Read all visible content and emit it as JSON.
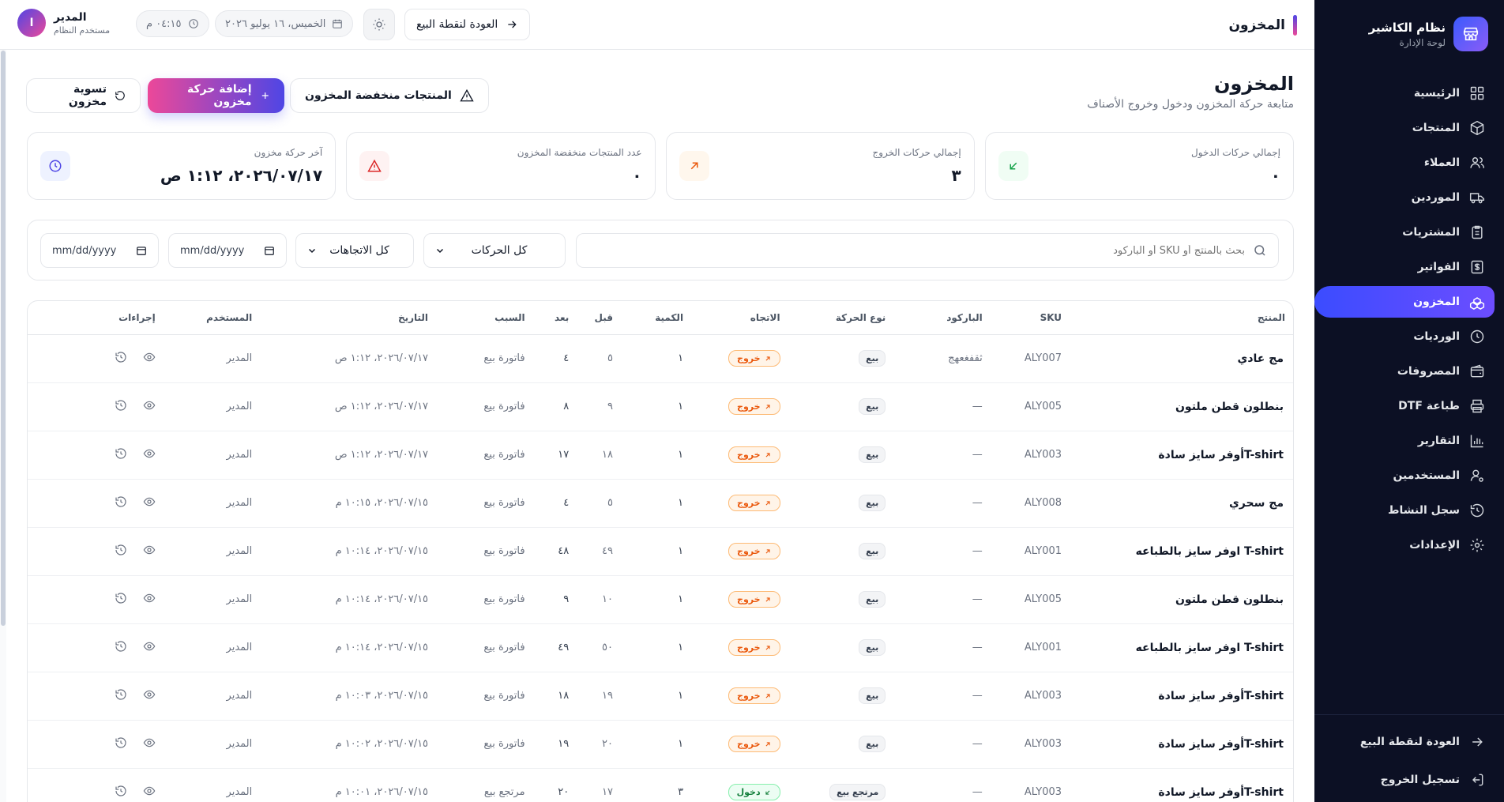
{
  "brand": {
    "title": "نظام الكاشير",
    "subtitle": "لوحة الإدارة"
  },
  "nav": [
    {
      "label": "الرئيسية",
      "icon": "dashboard-icon"
    },
    {
      "label": "المنتجات",
      "icon": "box-icon"
    },
    {
      "label": "العملاء",
      "icon": "users-icon"
    },
    {
      "label": "الموردين",
      "icon": "truck-icon"
    },
    {
      "label": "المشتريات",
      "icon": "clipboard-icon"
    },
    {
      "label": "الفواتير",
      "icon": "receipt-icon"
    },
    {
      "label": "المخزون",
      "icon": "boxes-icon",
      "active": true
    },
    {
      "label": "الورديات",
      "icon": "clock-icon"
    },
    {
      "label": "المصروفات",
      "icon": "wallet-icon"
    },
    {
      "label": "طباعة DTF",
      "icon": "printer-icon"
    },
    {
      "label": "التقارير",
      "icon": "chart-icon"
    },
    {
      "label": "المستخدمين",
      "icon": "user-cog-icon"
    },
    {
      "label": "سجل النشاط",
      "icon": "history-icon"
    },
    {
      "label": "الإعدادات",
      "icon": "gear-icon"
    }
  ],
  "sidebar_bottom": {
    "back_pos": "العودة لنقطة البيع",
    "logout": "تسجيل الخروج"
  },
  "header": {
    "title": "المخزون",
    "back_pos": "العودة لنقطة البيع",
    "date": "الخميس، ١٦ يوليو ٢٠٢٦",
    "time": "٠٤:١٥ م",
    "user_name": "المدير",
    "user_role": "مستخدم النظام",
    "avatar_letter": "ا"
  },
  "page": {
    "title": "المخزون",
    "subtitle": "متابعة حركة المخزون ودخول وخروج الأصناف",
    "btn_low_stock": "المنتجات منخفضة المخزون",
    "btn_add_movement": "إضافة حركة مخزون",
    "btn_adjust": "تسوية مخزون"
  },
  "stats": [
    {
      "label": "إجمالي حركات الدخول",
      "value": "٠",
      "icon": "arrow-down-left-icon",
      "color": "#16a34a",
      "bg": "#f0fdf4"
    },
    {
      "label": "إجمالي حركات الخروج",
      "value": "٣",
      "icon": "arrow-up-right-icon",
      "color": "#ea580c",
      "bg": "#fff7ed"
    },
    {
      "label": "عدد المنتجات منخفضة المخزون",
      "value": "٠",
      "icon": "warning-icon",
      "color": "#dc2626",
      "bg": "#fef2f2"
    },
    {
      "label": "آخر حركة مخزون",
      "value": "٢٠٢٦/٠٧/١٧، ١:١٢ ص",
      "icon": "clock-icon",
      "color": "#4f46e5",
      "bg": "#eef2ff"
    }
  ],
  "filters": {
    "search_placeholder": "بحث بالمنتج أو SKU أو الباركود",
    "movement_type": "كل الحركات",
    "direction": "كل الاتجاهات",
    "date_from": "mm/dd/yyyy",
    "date_to": "mm/dd/yyyy"
  },
  "table": {
    "columns": [
      "المنتج",
      "SKU",
      "الباركود",
      "نوع الحركة",
      "الاتجاه",
      "الكمية",
      "قبل",
      "بعد",
      "السبب",
      "التاريخ",
      "المستخدم",
      "إجراءات"
    ],
    "rows": [
      {
        "product": "مج عادي",
        "sku": "ALY007",
        "barcode": "ثقفغعهج",
        "type": "بيع",
        "direction": "خروج",
        "dir": "out",
        "qty": "١",
        "before": "٥",
        "after": "٤",
        "reason": "فاتورة بيع",
        "date": "٢٠٢٦/٠٧/١٧، ١:١٢ ص",
        "user": "المدير"
      },
      {
        "product": "بنطلون قطن ملتون",
        "sku": "ALY005",
        "barcode": "—",
        "type": "بيع",
        "direction": "خروج",
        "dir": "out",
        "qty": "١",
        "before": "٩",
        "after": "٨",
        "reason": "فاتورة بيع",
        "date": "٢٠٢٦/٠٧/١٧، ١:١٢ ص",
        "user": "المدير"
      },
      {
        "product": "T-shirtأوفر سايز سادة",
        "sku": "ALY003",
        "barcode": "—",
        "type": "بيع",
        "direction": "خروج",
        "dir": "out",
        "qty": "١",
        "before": "١٨",
        "after": "١٧",
        "reason": "فاتورة بيع",
        "date": "٢٠٢٦/٠٧/١٧، ١:١٢ ص",
        "user": "المدير"
      },
      {
        "product": "مج سحري",
        "sku": "ALY008",
        "barcode": "—",
        "type": "بيع",
        "direction": "خروج",
        "dir": "out",
        "qty": "١",
        "before": "٥",
        "after": "٤",
        "reason": "فاتورة بيع",
        "date": "٢٠٢٦/٠٧/١٥، ١٠:١٥ م",
        "user": "المدير"
      },
      {
        "product": "T-shirt اوفر سايز بالطباعه",
        "sku": "ALY001",
        "barcode": "—",
        "type": "بيع",
        "direction": "خروج",
        "dir": "out",
        "qty": "١",
        "before": "٤٩",
        "after": "٤٨",
        "reason": "فاتورة بيع",
        "date": "٢٠٢٦/٠٧/١٥، ١٠:١٤ م",
        "user": "المدير"
      },
      {
        "product": "بنطلون قطن ملتون",
        "sku": "ALY005",
        "barcode": "—",
        "type": "بيع",
        "direction": "خروج",
        "dir": "out",
        "qty": "١",
        "before": "١٠",
        "after": "٩",
        "reason": "فاتورة بيع",
        "date": "٢٠٢٦/٠٧/١٥، ١٠:١٤ م",
        "user": "المدير"
      },
      {
        "product": "T-shirt اوفر سايز بالطباعه",
        "sku": "ALY001",
        "barcode": "—",
        "type": "بيع",
        "direction": "خروج",
        "dir": "out",
        "qty": "١",
        "before": "٥٠",
        "after": "٤٩",
        "reason": "فاتورة بيع",
        "date": "٢٠٢٦/٠٧/١٥، ١٠:١٤ م",
        "user": "المدير"
      },
      {
        "product": "T-shirtأوفر سايز سادة",
        "sku": "ALY003",
        "barcode": "—",
        "type": "بيع",
        "direction": "خروج",
        "dir": "out",
        "qty": "١",
        "before": "١٩",
        "after": "١٨",
        "reason": "فاتورة بيع",
        "date": "٢٠٢٦/٠٧/١٥، ١٠:٠٣ م",
        "user": "المدير"
      },
      {
        "product": "T-shirtأوفر سايز سادة",
        "sku": "ALY003",
        "barcode": "—",
        "type": "بيع",
        "direction": "خروج",
        "dir": "out",
        "qty": "١",
        "before": "٢٠",
        "after": "١٩",
        "reason": "فاتورة بيع",
        "date": "٢٠٢٦/٠٧/١٥، ١٠:٠٢ م",
        "user": "المدير"
      },
      {
        "product": "T-shirtأوفر سايز سادة",
        "sku": "ALY003",
        "barcode": "—",
        "type": "مرتجع بيع",
        "direction": "دخول",
        "dir": "in",
        "qty": "٣",
        "before": "١٧",
        "after": "٢٠",
        "reason": "مرتجع بيع",
        "date": "٢٠٢٦/٠٧/١٥، ١٠:٠١ م",
        "user": "المدير"
      }
    ]
  }
}
